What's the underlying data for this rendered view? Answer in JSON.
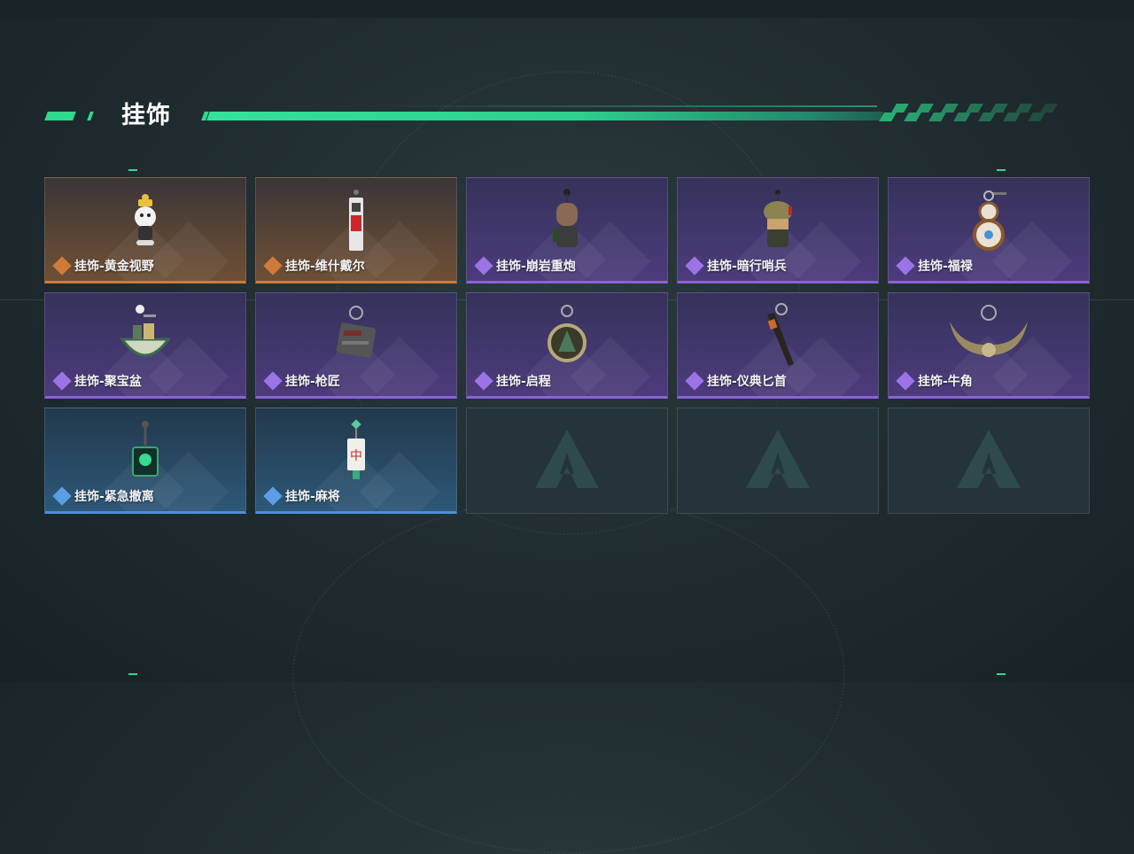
{
  "header": {
    "title": "挂饰"
  },
  "colors": {
    "accent": "#2fd98e",
    "gold": "#d07a3a",
    "purple": "#8a63d6",
    "blue": "#4f8ed6"
  },
  "items": [
    {
      "name": "挂饰-黄金视野",
      "rarity": "gold",
      "icon": "golden-cat-charm-icon"
    },
    {
      "name": "挂饰-维什戴尔",
      "rarity": "gold",
      "icon": "red-tag-charm-icon"
    },
    {
      "name": "挂饰-崩岩重炮",
      "rarity": "purple",
      "icon": "soldier-figure-charm-icon"
    },
    {
      "name": "挂饰-暗行哨兵",
      "rarity": "purple",
      "icon": "camo-soldier-charm-icon"
    },
    {
      "name": "挂饰-福禄",
      "rarity": "purple",
      "icon": "gourd-charm-icon"
    },
    {
      "name": "挂饰-聚宝盆",
      "rarity": "purple",
      "icon": "treasure-bowl-charm-icon"
    },
    {
      "name": "挂饰-枪匠",
      "rarity": "purple",
      "icon": "gun-part-charm-icon"
    },
    {
      "name": "挂饰-启程",
      "rarity": "purple",
      "icon": "compass-ring-charm-icon"
    },
    {
      "name": "挂饰-仪典匕首",
      "rarity": "purple",
      "icon": "dagger-charm-icon"
    },
    {
      "name": "挂饰-牛角",
      "rarity": "purple",
      "icon": "bull-horn-charm-icon"
    },
    {
      "name": "挂饰-紧急撤离",
      "rarity": "blue",
      "icon": "skull-badge-charm-icon"
    },
    {
      "name": "挂饰-麻将",
      "rarity": "blue",
      "icon": "mahjong-tile-charm-icon"
    }
  ],
  "empty_slots": 3
}
